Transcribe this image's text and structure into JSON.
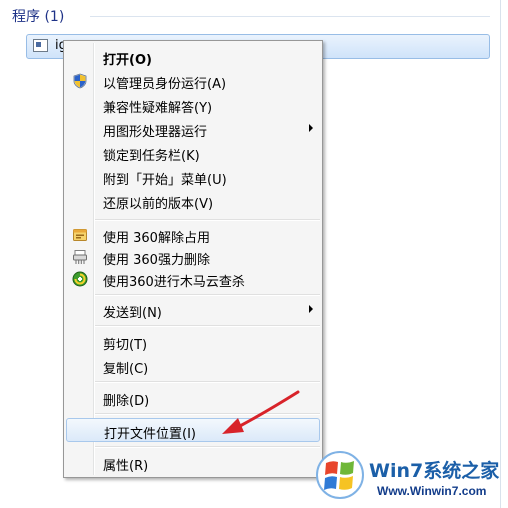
{
  "start_menu": {
    "section_header": "程序 (1)",
    "result_item": {
      "label": "ig",
      "icon": "application-icon"
    }
  },
  "context_menu": {
    "items": [
      {
        "label": "打开(O)",
        "bold": true
      },
      {
        "label": "以管理员身份运行(A)",
        "icon": "uac-shield-icon"
      },
      {
        "label": "兼容性疑难解答(Y)"
      },
      {
        "label": "用图形处理器运行",
        "submenu": true
      },
      {
        "label": "锁定到任务栏(K)"
      },
      {
        "label": "附到「开始」菜单(U)"
      },
      {
        "label": "还原以前的版本(V)"
      },
      {
        "label": "使用 360解除占用",
        "icon": "360-unlock-icon"
      },
      {
        "label": "使用 360强力删除",
        "icon": "360-shred-icon"
      },
      {
        "label": "使用360进行木马云查杀",
        "icon": "360-scan-icon"
      },
      {
        "label": "发送到(N)",
        "submenu": true
      },
      {
        "label": "剪切(T)"
      },
      {
        "label": "复制(C)"
      },
      {
        "label": "删除(D)"
      },
      {
        "label": "打开文件位置(I)",
        "highlighted": true
      },
      {
        "label": "属性(R)"
      }
    ]
  },
  "annotation": {
    "type": "red-arrow",
    "color": "#d8232a"
  },
  "watermark": {
    "title": "Win7系统之家",
    "url": "Www.Winwin7.com"
  },
  "colors": {
    "menu_background": "#f5f5f5",
    "selection_border": "#98bde6",
    "header_text": "#1e3287"
  }
}
